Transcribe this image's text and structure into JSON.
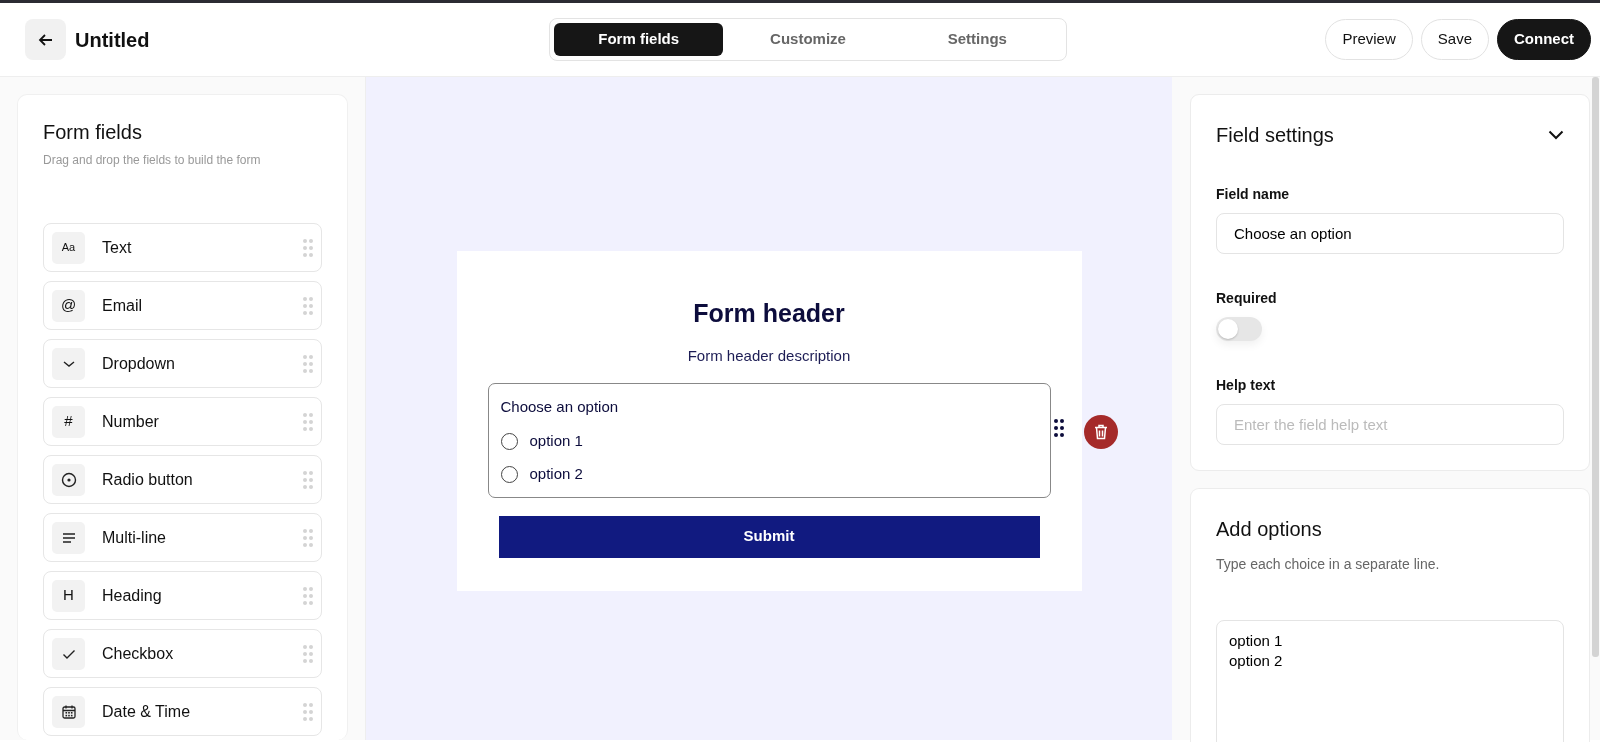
{
  "header": {
    "title": "Untitled",
    "tabs": [
      {
        "label": "Form fields",
        "selected": true
      },
      {
        "label": "Customize",
        "selected": false
      },
      {
        "label": "Settings",
        "selected": false
      }
    ],
    "buttons": [
      {
        "label": "Preview",
        "kind": "outline"
      },
      {
        "label": "Save",
        "kind": "outline"
      },
      {
        "label": "Connect",
        "kind": "dark"
      }
    ]
  },
  "sidebar": {
    "title": "Form fields",
    "subtitle": "Drag and drop the fields to build the form",
    "items": [
      {
        "label": "Text",
        "kind": "glyph",
        "glyph": "Aa"
      },
      {
        "label": "Email",
        "kind": "glyph",
        "glyph": "@"
      },
      {
        "label": "Dropdown",
        "kind": "chevron"
      },
      {
        "label": "Number",
        "kind": "glyph",
        "glyph": "#"
      },
      {
        "label": "Radio button",
        "kind": "radio"
      },
      {
        "label": "Multi-line",
        "kind": "lines"
      },
      {
        "label": "Heading",
        "kind": "glyph",
        "glyph": "H"
      },
      {
        "label": "Checkbox",
        "kind": "check"
      },
      {
        "label": "Date & Time",
        "kind": "calendar"
      }
    ]
  },
  "form": {
    "title": "Form header",
    "description": "Form header description",
    "field": {
      "label": "Choose an option",
      "options": [
        {
          "label": "option 1",
          "checked": false
        },
        {
          "label": "option 2",
          "checked": false
        }
      ]
    },
    "submit": "Submit"
  },
  "field_settings": {
    "title": "Field settings",
    "expanded": true,
    "field_name_label": "Field name",
    "field_name_value": "Choose an option",
    "required_label": "Required",
    "required_on": false,
    "help_label": "Help text",
    "help_placeholder": "Enter the field help text"
  },
  "add_options": {
    "title": "Add options",
    "subtitle": "Type each choice in a separate line.",
    "value": "option 1\noption 2"
  }
}
